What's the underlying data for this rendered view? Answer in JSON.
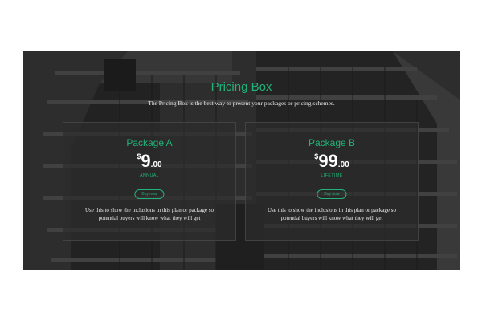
{
  "header": {
    "title": "Pricing Box",
    "subtitle": "The Pricing Box is the best way to present your packages or pricing schemes."
  },
  "packages": [
    {
      "name": "Package A",
      "currency": "$",
      "amount": "9",
      "cents": ".00",
      "period": "ANNUAL",
      "button_label": "Buy now",
      "description": "Use this to show the inclusions in this plan or package so potential buyers will know what they will get"
    },
    {
      "name": "Package B",
      "currency": "$",
      "amount": "99",
      "cents": ".00",
      "period": "LIFETIME",
      "button_label": "Buy now",
      "description": "Use this to show the inclusions in this plan or package so potential buyers will know what they will get"
    }
  ],
  "colors": {
    "accent": "#22b37a",
    "card_background": "#2d2d2d",
    "text": "#ffffff"
  }
}
